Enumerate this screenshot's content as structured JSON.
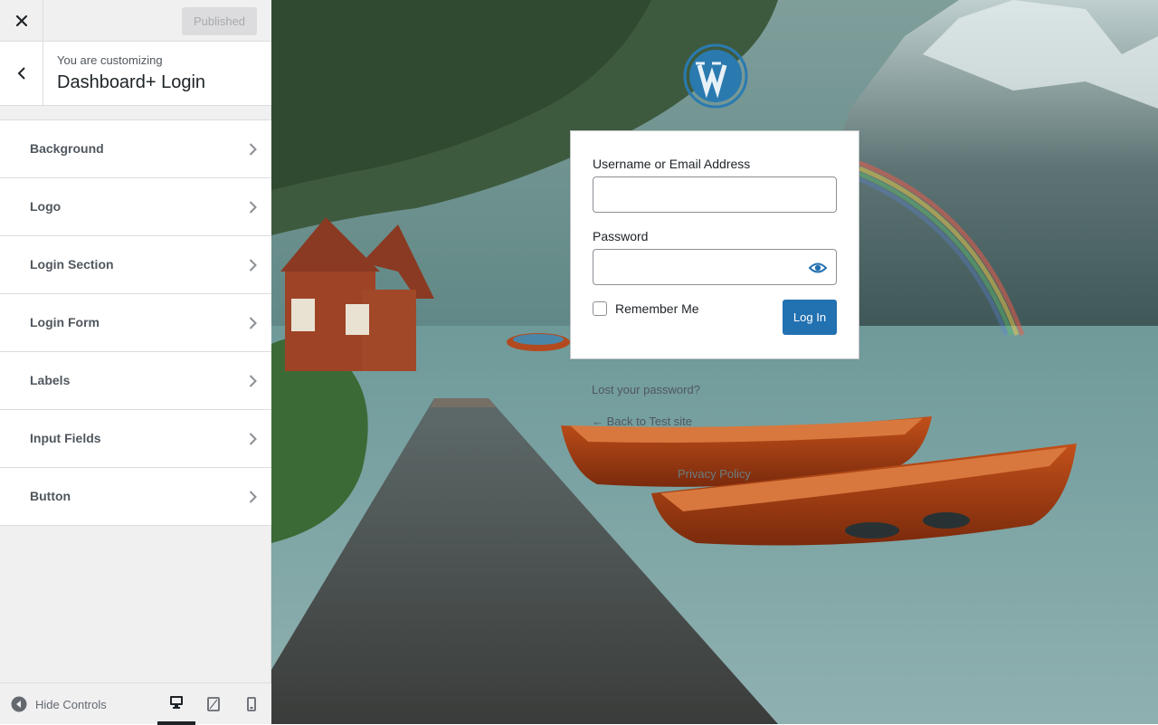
{
  "topbar": {
    "publish_label": "Published"
  },
  "header": {
    "subtitle": "You are customizing",
    "title": "Dashboard+ Login"
  },
  "sections": [
    {
      "label": "Background"
    },
    {
      "label": "Logo"
    },
    {
      "label": "Login Section"
    },
    {
      "label": "Login Form"
    },
    {
      "label": "Labels"
    },
    {
      "label": "Input Fields"
    },
    {
      "label": "Button"
    }
  ],
  "footer": {
    "hide_controls_label": "Hide Controls",
    "active_device": "desktop"
  },
  "preview": {
    "username_label": "Username or Email Address",
    "username_value": "",
    "password_label": "Password",
    "password_value": "",
    "remember_label": "Remember Me",
    "login_button": "Log In",
    "lost_password": "Lost your password?",
    "back_to_site": "← Back to Test site",
    "privacy": "Privacy Policy"
  },
  "colors": {
    "accent": "#2271b1",
    "wp_logo": "#2a7ab0"
  },
  "icons": {
    "close": "close-icon",
    "back": "chevron-left-icon",
    "section_chevron": "chevron-right-icon",
    "hide_controls": "collapse-arrow-icon",
    "desktop": "desktop-icon",
    "tablet": "tablet-icon",
    "mobile": "mobile-icon",
    "show_password": "eye-icon",
    "logo": "wordpress-logo-icon"
  }
}
